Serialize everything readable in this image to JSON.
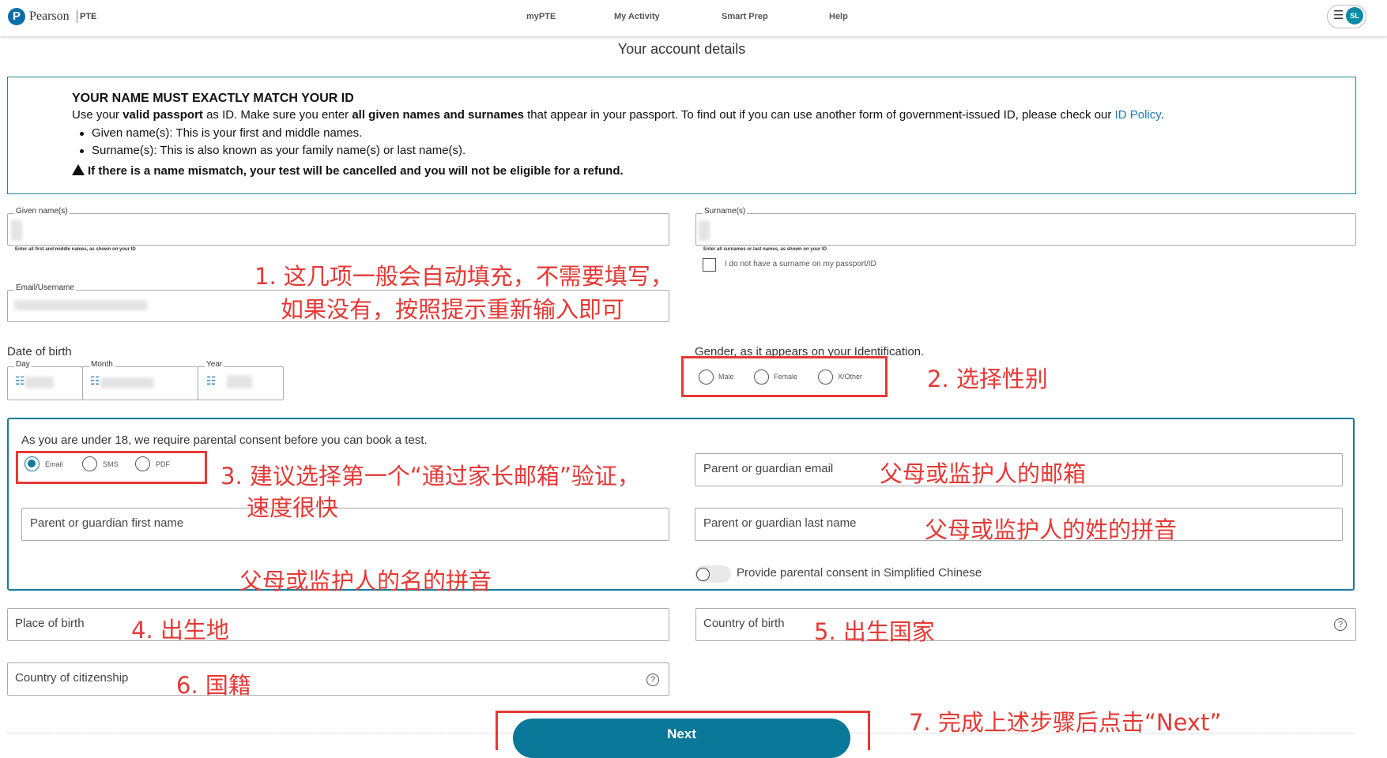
{
  "header": {
    "logo_mark": "P",
    "logo_text": "Pearson",
    "logo_sub": "PTE",
    "nav": [
      "myPTE",
      "My Activity",
      "Smart Prep",
      "Help"
    ],
    "menu_icon": "hamburger-icon",
    "avatar": "SL"
  },
  "page_title": "Your account details",
  "notice": {
    "heading": "YOUR NAME MUST EXACTLY MATCH YOUR ID",
    "line_part1": "Use your ",
    "line_bold1": "valid passport",
    "line_part2": " as ID. Make sure you enter ",
    "line_bold2": "all given names and surnames",
    "line_part3": " that appear in your passport. To find out if you can use another form of government-issued ID, please check our ",
    "link": "ID Policy",
    "line_end": ".",
    "bullets": [
      "Given name(s): This is your first and middle names.",
      "Surname(s): This is also known as your family name(s) or last name(s)."
    ],
    "warning": "If there is a name mismatch, your test will be cancelled and you will not be eligible for a refund."
  },
  "form": {
    "given_legend": "Given name(s)",
    "given_hint": "Enter all first and middle names, as shown on your ID",
    "surname_legend": "Surname(s)",
    "surname_hint": "Enter all surnames or last names, as shown on your ID",
    "no_surname": "I do not have a surname on my passport/ID",
    "email_legend": "Email/Username",
    "dob_label": "Date of birth",
    "day": "Day",
    "month": "Month",
    "year": "Year",
    "gender_label": "Gender, as it appears on your Identification.",
    "gender_options": [
      "Male",
      "Female",
      "X/Other"
    ],
    "consent_text": "As you are under 18, we require parental consent before you can book a test.",
    "consent_options": [
      "Email",
      "SMS",
      "PDF"
    ],
    "parent_email": "Parent or guardian email",
    "parent_first": "Parent or guardian first name",
    "parent_last": "Parent or guardian last name",
    "chinese_toggle": "Provide parental consent in Simplified Chinese",
    "place_of_birth": "Place of birth",
    "country_of_birth": "Country of birth",
    "citizenship": "Country of citizenship",
    "help": "?",
    "next": "Next"
  },
  "annotations": {
    "a1_line1": "1. 这几项一般会自动填充，不需要填写，",
    "a1_line2": "如果没有，按照提示重新输入即可",
    "a2": "2. 选择性别",
    "a3_line1": "3. 建议选择第一个“通过家长邮箱”验证，",
    "a3_line2": "速度很快",
    "a_email": "父母或监护人的邮箱",
    "a_last": "父母或监护人的姓的拼音",
    "a_first": "父母或监护人的名的拼音",
    "a4": "4. 出生地",
    "a5": "5. 出生国家",
    "a6": "6. 国籍",
    "a7": "7. 完成上述步骤后点击“Next”"
  },
  "colors": {
    "brand": "#0b6ea8",
    "teal_border": "#137a9b",
    "button": "#0a7898",
    "annotation": "#e53935",
    "link": "#1a7ab5"
  }
}
